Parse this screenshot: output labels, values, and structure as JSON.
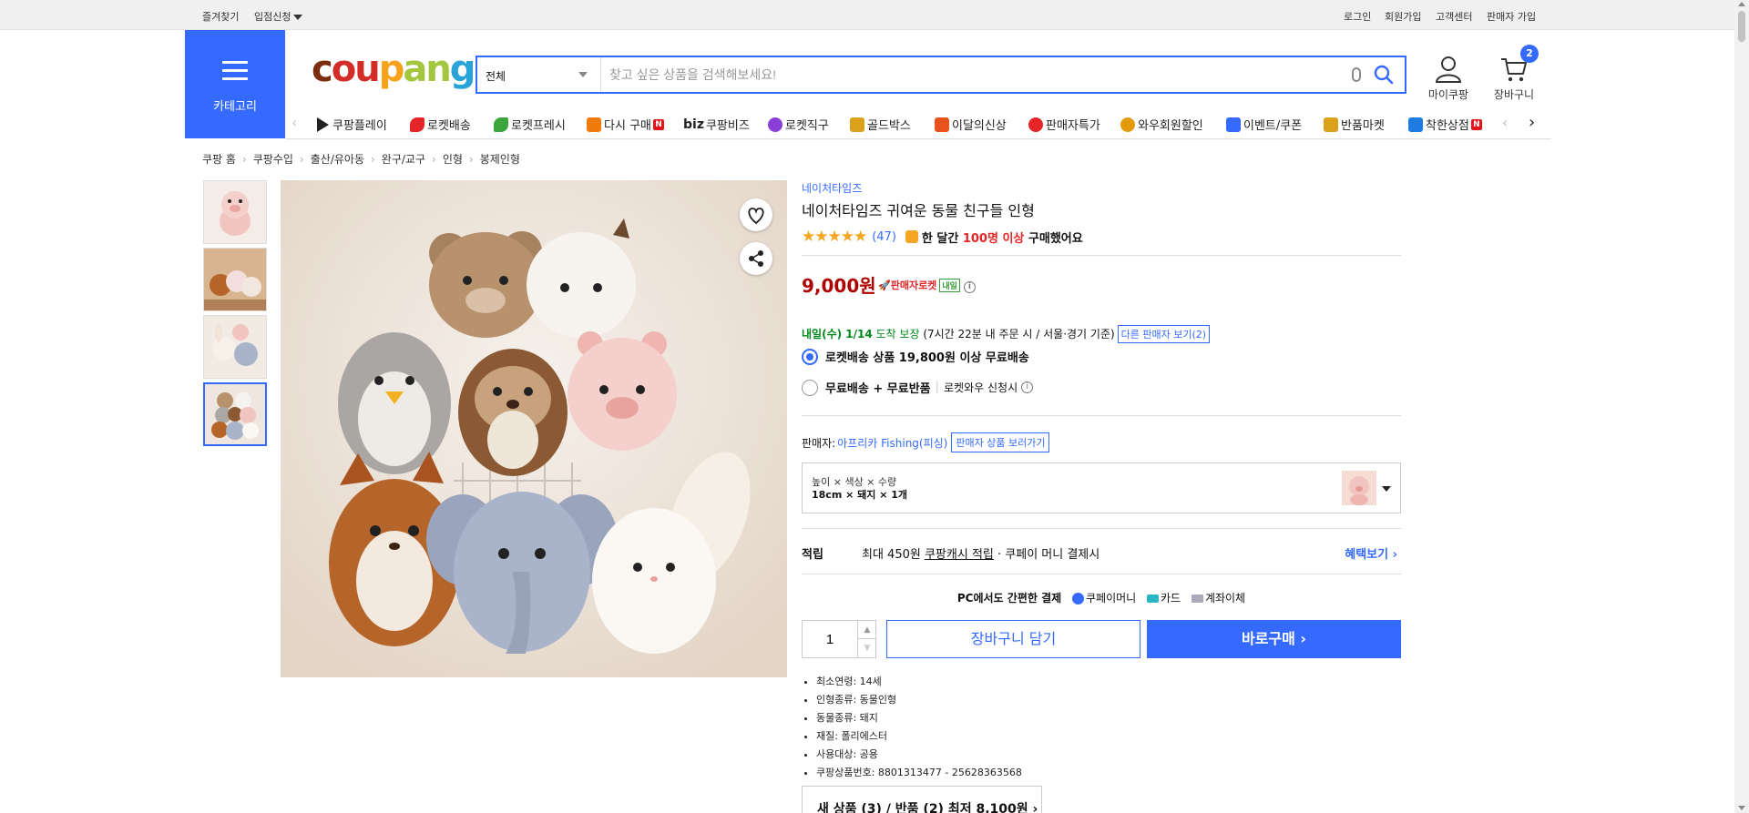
{
  "topbar": {
    "favorites": "즐겨찾기",
    "seller_entry": "입점신청",
    "login": "로그인",
    "signup": "회원가입",
    "customer_center": "고객센터",
    "seller_signup": "판매자 가입"
  },
  "header": {
    "category_label": "카테고리",
    "logo": {
      "c1": "c",
      "c2": "ou",
      "c3": "p",
      "c4": "an",
      "c5": "g"
    },
    "search": {
      "scope": "전체",
      "placeholder": "찾고 싶은 상품을 검색해보세요!"
    },
    "my_coupang": "마이쿠팡",
    "cart": "장바구니",
    "cart_count": "2"
  },
  "nav": {
    "items": [
      {
        "label": "쿠팡플레이",
        "icon": "play-icon",
        "color": "#222"
      },
      {
        "label": "로켓배송",
        "icon": "rocket-icon",
        "color": "#e52528"
      },
      {
        "label": "로켓프레시",
        "icon": "rocket-fresh-icon",
        "color": "#3aa53a"
      },
      {
        "label": "다시 구매",
        "icon": "repurchase-icon",
        "color": "#f07a0c"
      },
      {
        "label": "쿠팡비즈",
        "prefix": "biz",
        "icon": "biz-icon",
        "color": "#222"
      },
      {
        "label": "로켓직구",
        "icon": "rocket-global-icon",
        "color": "#8a3fd8"
      },
      {
        "label": "골드박스",
        "icon": "goldbox-icon",
        "color": "#d9a21a"
      },
      {
        "label": "이달의신상",
        "icon": "new-icon",
        "color": "#e8531c"
      },
      {
        "label": "판매자특가",
        "icon": "seller-deal-icon",
        "color": "#e52528"
      },
      {
        "label": "와우회원할인",
        "icon": "wow-icon",
        "color": "#e59a0e"
      },
      {
        "label": "이벤트/쿠폰",
        "icon": "coupon-icon",
        "color": "#346aff"
      },
      {
        "label": "반품마켓",
        "icon": "return-market-icon",
        "color": "#d9a21a"
      },
      {
        "label": "착한상점",
        "icon": "good-store-icon",
        "color": "#1e7be0"
      }
    ],
    "new_badge": "N"
  },
  "breadcrumb": [
    "쿠팡 홈",
    "쿠팡수입",
    "출산/유아동",
    "완구/교구",
    "인형",
    "봉제인형"
  ],
  "product": {
    "brand": "네이처타임즈",
    "title": "네이처타임즈 귀여운 동물 친구들 인형",
    "stars": "★★★★★",
    "review_count": "(47)",
    "buy_text_pre": "한 달간 ",
    "buy_text_hl": "100명 이상",
    "buy_text_post": " 구매했어요",
    "price": "9,000원",
    "seller_rocket": "판매자로켓",
    "tomorrow_tag": "내일",
    "delivery_date": "내일(수) 1/14",
    "delivery_guarantee": " 도착 보장 ",
    "delivery_condition": "(7시간 22분 내 주문 시 / 서울·경기 기준)",
    "other_sellers": "다른 판매자 보기(2)",
    "shipping_options": [
      {
        "label": "로켓배송 상품 19,800원 이상 무료배송",
        "selected": true,
        "note": ""
      },
      {
        "label": "무료배송 + 무료반품",
        "selected": false,
        "note": "로켓와우 신청시"
      }
    ],
    "seller_label": "판매자: ",
    "seller_name": "아프리카 Fishing(피싱)",
    "seller_products": "판매자 상품 보러가기",
    "option_header": "높이 × 색상 × 수량",
    "option_value": "18cm × 돼지 × 1개",
    "points_label": "적립",
    "points_text_1": "최대 450원 ",
    "points_text_ul": "쿠팡캐시 적립",
    "points_text_2": " · 쿠페이 머니 결제시",
    "benefits": "혜택보기 ›",
    "pay_intro": "PC에서도 간편한 결제",
    "pay_methods": [
      "쿠페이머니",
      "카드",
      "계좌이체"
    ],
    "quantity": "1",
    "add_to_cart": "장바구니 담기",
    "buy_now": "바로구매 ›",
    "specs": [
      "최소연령: 14세",
      "인형종류: 동물인형",
      "동물종류: 돼지",
      "재질: 폴리에스터",
      "사용대상: 공용",
      "쿠팡상품번호: 8801313477 - 25628363568"
    ],
    "new_used": "새 상품 (3) / 반품 (2) 최저 8,100원 ›"
  },
  "colors": {
    "accent": "#346aff",
    "price": "#ae0000",
    "delivery": "#00891a",
    "star": "#f5a623"
  }
}
